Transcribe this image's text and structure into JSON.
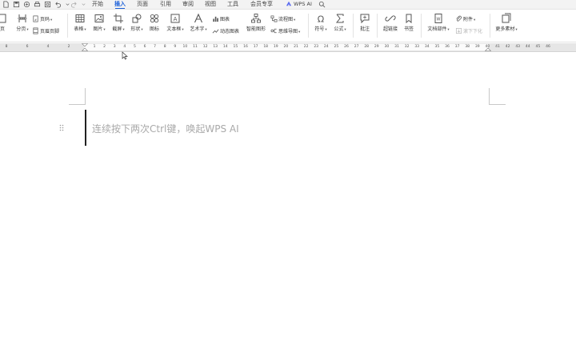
{
  "menu": {
    "tabs": [
      {
        "label": "开始",
        "active": false
      },
      {
        "label": "插入",
        "active": true
      },
      {
        "label": "页面",
        "active": false
      },
      {
        "label": "引用",
        "active": false
      },
      {
        "label": "审阅",
        "active": false
      },
      {
        "label": "视图",
        "active": false
      },
      {
        "label": "工具",
        "active": false
      },
      {
        "label": "会员专享",
        "active": false
      }
    ],
    "wps_ai": "WPS AI",
    "accent": "#1a5fd9"
  },
  "ribbon": {
    "page_partial": "页",
    "section": "分页",
    "page_number": "页码",
    "header_footer": "页眉页脚",
    "table": "表格",
    "picture": "图片",
    "screenshot": "截屏",
    "shape": "形状",
    "icon": "图标",
    "textbox": "文本框",
    "wordart": "艺术字",
    "chart": "图表",
    "dynamic_chart": "动态图表",
    "smart_art": "智能图形",
    "flowchart": "流程图",
    "mindmap": "思维导图",
    "symbol": "符号",
    "formula": "公式",
    "comment": "批注",
    "hyperlink": "超链接",
    "bookmark": "书签",
    "doc_parts": "文档部件",
    "attachment": "附件",
    "scroll_down": "滚下下化",
    "more_materials": "更多素材"
  },
  "ruler": {
    "left_numbers": [
      "8",
      "6",
      "4",
      "2"
    ],
    "numbers": [
      "1",
      "2",
      "3",
      "4",
      "5",
      "6",
      "7",
      "8",
      "9",
      "10",
      "11",
      "12",
      "13",
      "14",
      "15",
      "16",
      "17",
      "18",
      "19",
      "20",
      "21",
      "22",
      "23",
      "24",
      "25",
      "26",
      "27",
      "28",
      "29",
      "30",
      "31",
      "32",
      "33",
      "34",
      "35",
      "36",
      "37",
      "38",
      "39",
      "40",
      "41",
      "42",
      "43",
      "44",
      "45",
      "46"
    ]
  },
  "document": {
    "hint_text": "连续按下两次Ctrl键，唤起WPS AI"
  }
}
